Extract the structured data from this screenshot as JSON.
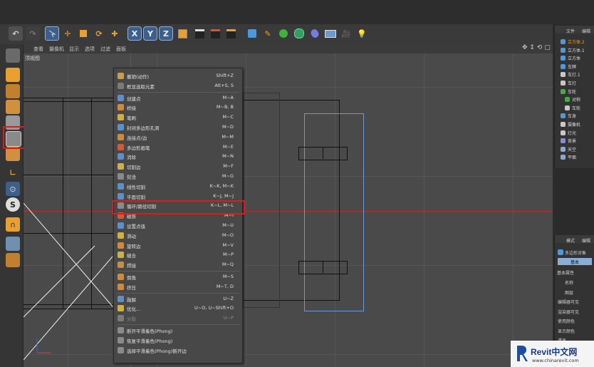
{
  "toolbar_axes": [
    "X",
    "Y",
    "Z"
  ],
  "viewport_menu": [
    "查看",
    "摄像机",
    "显示",
    "选项",
    "过滤",
    "面板"
  ],
  "viewport_title": "顶视图",
  "context_menu": {
    "items": [
      {
        "label": "撤销(动作)",
        "shortcut": "Shift+Z",
        "icon_color": "#c9a04a"
      },
      {
        "label": "框显选取元素",
        "shortcut": "Alt+S, S",
        "icon_color": "#7a7a7a"
      },
      {
        "sep": true
      },
      {
        "label": "创建点",
        "shortcut": "M~A",
        "icon_color": "#5a8fd0"
      },
      {
        "label": "桥接",
        "shortcut": "M~B, B",
        "icon_color": "#d08a3a"
      },
      {
        "label": "笔刷",
        "shortcut": "M~C",
        "icon_color": "#d0b040"
      },
      {
        "label": "封闭多边形孔洞",
        "shortcut": "M~D",
        "icon_color": "#5a8fd0"
      },
      {
        "label": "连接点/边",
        "shortcut": "M~M",
        "icon_color": "#d08a3a"
      },
      {
        "label": "多边形画笔",
        "shortcut": "M~E",
        "icon_color": "#d05a3a"
      },
      {
        "label": "消除",
        "shortcut": "M~N",
        "icon_color": "#5a8fd0"
      },
      {
        "label": "切割边",
        "shortcut": "M~F",
        "icon_color": "#d0b040"
      },
      {
        "label": "熨烫",
        "shortcut": "M~G",
        "icon_color": "#8a8a8a"
      },
      {
        "label": "线性切割",
        "shortcut": "K~K, M~K",
        "icon_color": "#5a8fd0"
      },
      {
        "label": "平面切割",
        "shortcut": "K~J, M~J",
        "icon_color": "#5a8fd0"
      },
      {
        "label": "循环/路径切割",
        "shortcut": "K~L, M~L",
        "icon_color": "#8a8a8a"
      },
      {
        "label": "磁铁",
        "shortcut": "M~I",
        "icon_color": "#d05a3a"
      },
      {
        "label": "设置点值",
        "shortcut": "M~U",
        "icon_color": "#5a8fd0"
      },
      {
        "label": "滑动",
        "shortcut": "M~O",
        "icon_color": "#d0b040"
      },
      {
        "label": "旋转边",
        "shortcut": "M~V",
        "icon_color": "#d08a3a"
      },
      {
        "label": "缝合",
        "shortcut": "M~P",
        "icon_color": "#d0b040"
      },
      {
        "label": "焊接",
        "shortcut": "M~Q",
        "icon_color": "#d08a3a"
      },
      {
        "sep": true
      },
      {
        "label": "倒角",
        "shortcut": "M~S",
        "icon_color": "#d08a3a"
      },
      {
        "label": "挤压",
        "shortcut": "M~T, D",
        "icon_color": "#d08a3a"
      },
      {
        "sep": true
      },
      {
        "label": "融解",
        "shortcut": "U~Z",
        "icon_color": "#5a8fd0"
      },
      {
        "label": "优化...",
        "shortcut": "U~O, U~Shift+O",
        "icon_color": "#d0b040"
      },
      {
        "label": "分裂",
        "shortcut": "U~P",
        "icon_color": "#7a7a7a",
        "disabled": true
      },
      {
        "sep": true
      },
      {
        "label": "断开平滑着色(Phong)",
        "shortcut": "",
        "icon_color": "#8a8a8a"
      },
      {
        "label": "恢复平滑着色(Phong)",
        "shortcut": "",
        "icon_color": "#8a8a8a"
      },
      {
        "label": "选择平滑着色(Phong)断开边",
        "shortcut": "",
        "icon_color": "#8a8a8a"
      }
    ]
  },
  "object_manager": {
    "tabs": [
      "文件",
      "编辑"
    ],
    "objects": [
      "立方体.2",
      "立方体.1",
      "立方体",
      "车牌",
      "车灯.1",
      "车灯",
      "车轮",
      "对称",
      "车轮",
      "车身",
      "摄像机",
      "灯光",
      "背景",
      "天空",
      "平面"
    ]
  },
  "attribute_manager": {
    "tabs": [
      "模式",
      "编辑"
    ],
    "object_name": "多边形对象",
    "basic_tab": "基本",
    "section_title": "基本属性",
    "fields": [
      "名称",
      "图层",
      "编辑器可见",
      "渲染器可见",
      "使用颜色",
      "显示颜色",
      "透显"
    ]
  },
  "watermark": {
    "title": "Revit中文网",
    "url": "www.chinarevit.com"
  },
  "colors": {
    "highlight": "#e01a1a",
    "accent_blue": "#3e5f8a",
    "selection_outline": "#6a9ad0"
  }
}
